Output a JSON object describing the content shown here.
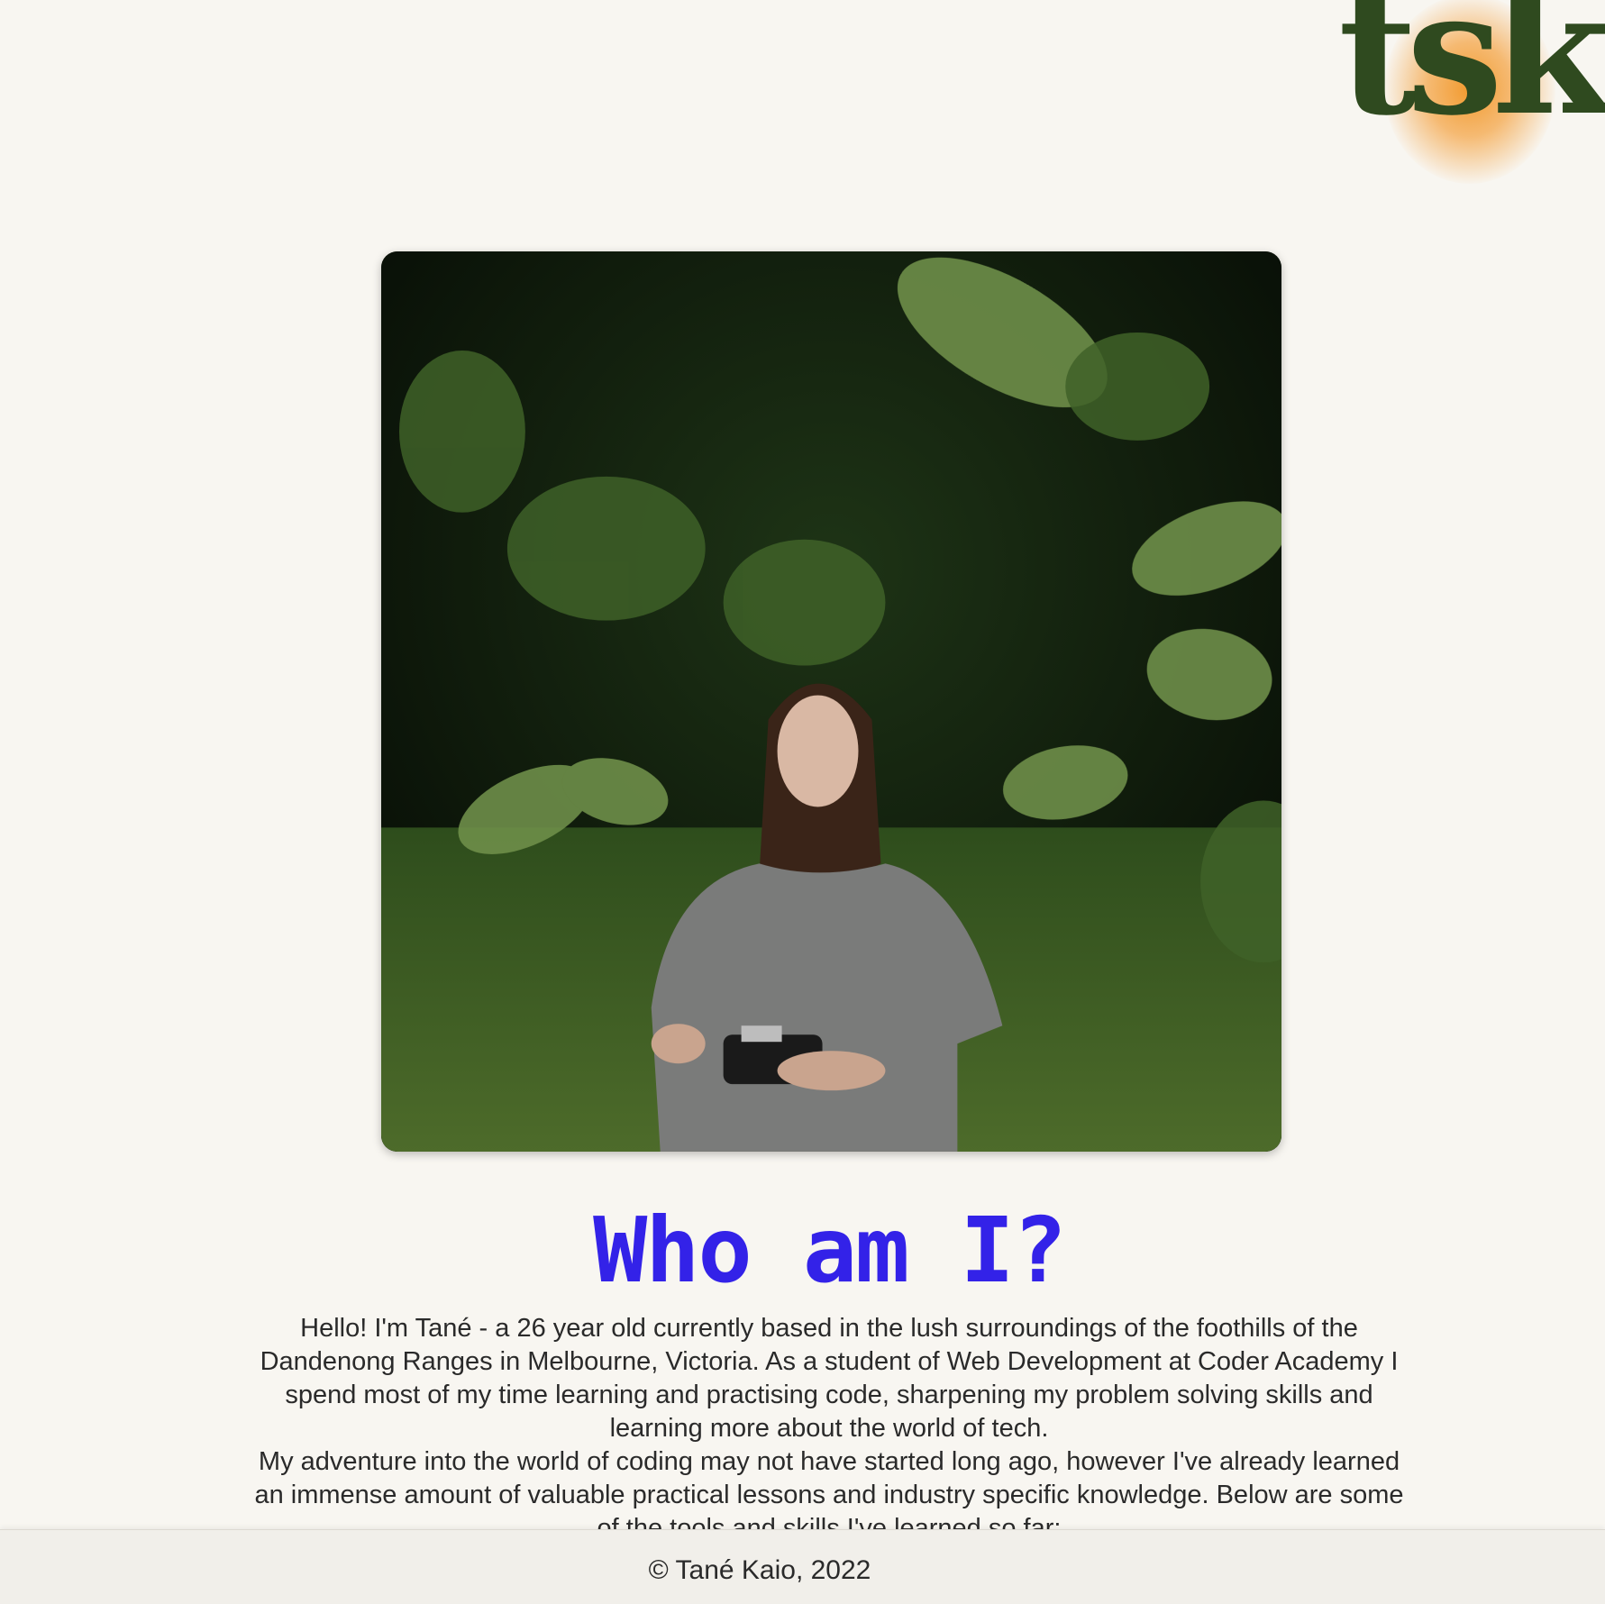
{
  "logo": {
    "text": "tsk",
    "icon": "tsk-monogram-logo"
  },
  "portrait": {
    "icon": "person-with-camera-in-ferns-photo"
  },
  "about": {
    "heading": "Who am I?",
    "paragraph1": "Hello! I'm Tané - a 26 year old currently based in the lush surroundings of the foothills of the Dandenong Ranges in Melbourne, Victoria. As a student of Web Development at Coder Academy I spend most of my time learning and practising code, sharpening my problem solving skills and learning more about the world of tech.",
    "paragraph2": "My adventure into the world of coding may not have started long ago, however I've already learned an immense amount of valuable practical lessons and industry specific knowledge. Below are some of the tools and skills I've learned so far:"
  },
  "footer": {
    "copyright": "© Tané Kaio, 2022"
  },
  "colors": {
    "heading": "#3322e8",
    "logo_green": "#2f4a1f",
    "logo_orange": "#f29a2e",
    "background": "#f8f6f1"
  }
}
